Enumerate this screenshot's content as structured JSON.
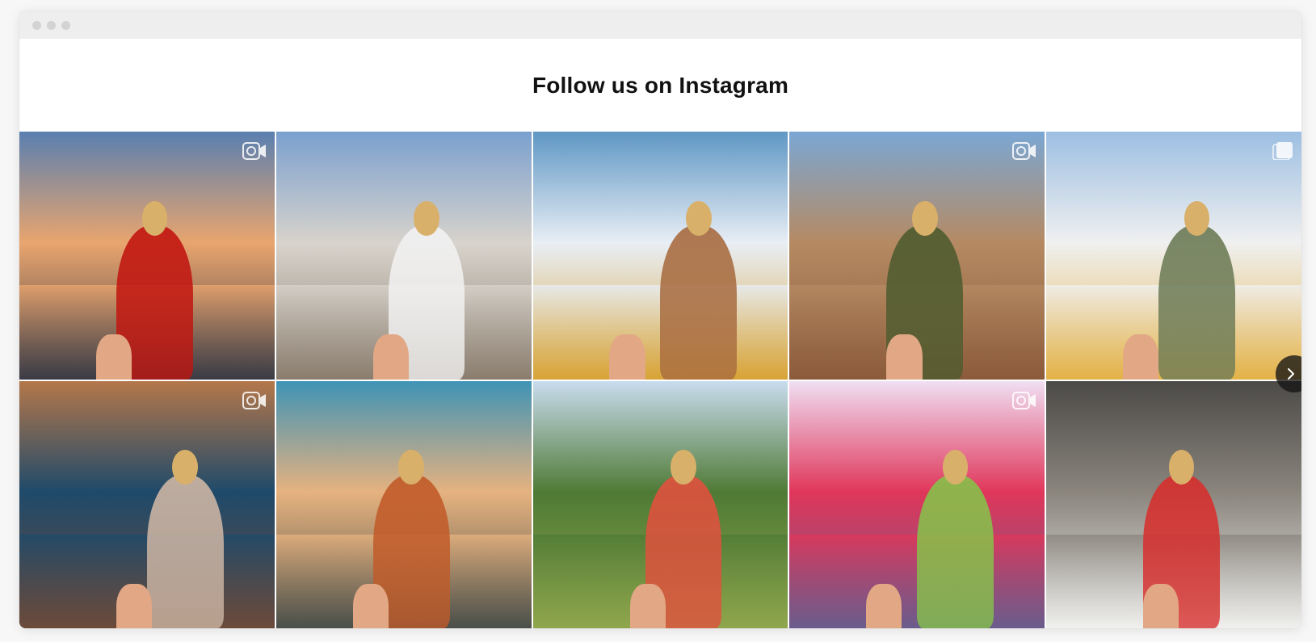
{
  "window": {
    "title_dots": [
      "close",
      "minimize",
      "maximize"
    ]
  },
  "header": {
    "title": "Follow us on Instagram"
  },
  "colors": {
    "window_bg": "#ffffff",
    "titlebar_bg": "#eeeeee",
    "title_text": "#111111",
    "nav_button_bg": "#1a1a1a"
  },
  "grid": {
    "columns": 5,
    "rows": 2,
    "posts": [
      {
        "id": "paris-arc",
        "badge": "video-icon",
        "palette": [
          "#5a7fb0",
          "#e9a56e",
          "#c1140e",
          "#3a3b46"
        ]
      },
      {
        "id": "paris-lion",
        "badge": "none",
        "palette": [
          "#7aa0cf",
          "#d8d3cc",
          "#f2f2f2",
          "#8a7d6e"
        ]
      },
      {
        "id": "canyon",
        "badge": "none",
        "palette": [
          "#5f97c4",
          "#e8eef5",
          "#a76a3e",
          "#d8a335"
        ]
      },
      {
        "id": "drill-site",
        "badge": "video-icon",
        "palette": [
          "#7ba7d4",
          "#b58a62",
          "#4d5b2e",
          "#8b5a3a"
        ]
      },
      {
        "id": "river-crowd",
        "badge": "gallery-icon",
        "palette": [
          "#9dbfe2",
          "#f0f0f0",
          "#6b7a55",
          "#e3b247"
        ]
      },
      {
        "id": "portrait-blue",
        "badge": "video-icon",
        "palette": [
          "#b4774a",
          "#1f4a6a",
          "#cfb7a5",
          "#6b4a3a"
        ]
      },
      {
        "id": "desert-tree",
        "badge": "none",
        "palette": [
          "#3f93b6",
          "#e6b27f",
          "#c15a28",
          "#4a4f4a"
        ]
      },
      {
        "id": "bali-terraces",
        "badge": "none",
        "palette": [
          "#c9dcef",
          "#4f7a35",
          "#e1503d",
          "#8fa64c"
        ]
      },
      {
        "id": "holi-festival",
        "badge": "video-icon",
        "palette": [
          "#f0dff3",
          "#e0365a",
          "#86c24a",
          "#6a5c8c"
        ]
      },
      {
        "id": "temple-mask",
        "badge": "none",
        "palette": [
          "#4c4a47",
          "#8a857d",
          "#d72e2c",
          "#f0f0ee"
        ]
      }
    ]
  },
  "nav": {
    "next_icon": "chevron-right-icon"
  }
}
